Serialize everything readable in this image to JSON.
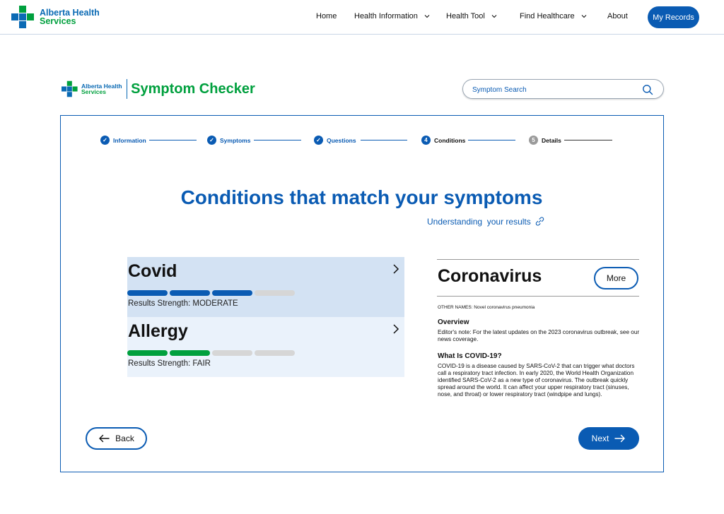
{
  "nav": {
    "logo_line1": "Alberta Health",
    "logo_line2": "Services",
    "items": [
      {
        "label": "Home"
      },
      {
        "label": "Health Information"
      },
      {
        "label": "Health Tool"
      },
      {
        "label": "Find Healthcare"
      },
      {
        "label": "About"
      }
    ],
    "records_button": "My Records"
  },
  "header": {
    "logo_line1": "Alberta Health",
    "logo_line2": "Services",
    "title": "Symptom Checker",
    "search_placeholder": "Symptom Search"
  },
  "steps": [
    {
      "label": "Information",
      "state": "done",
      "marker": "✓"
    },
    {
      "label": "Symptoms",
      "state": "done",
      "marker": "✓"
    },
    {
      "label": "Questions",
      "state": "done",
      "marker": "✓"
    },
    {
      "label": "Conditions",
      "state": "current",
      "marker": "4"
    },
    {
      "label": "Details",
      "state": "todo",
      "marker": "5"
    }
  ],
  "main": {
    "title": "Conditions that match your symptoms",
    "understand_link": "Understanding  your results"
  },
  "conditions": [
    {
      "name": "Covid",
      "strength_text": "Results Strength: MODERATE",
      "filled_segments": 3,
      "total_segments": 4,
      "color": "#0a5bb3"
    },
    {
      "name": "Allergy",
      "strength_text": "Results Strength: FAIR",
      "filled_segments": 2,
      "total_segments": 4,
      "color": "#00a03e"
    }
  ],
  "detail": {
    "title": "Coronavirus",
    "more_button": "More",
    "other_names": "OTHER NAMES: Novel coronavirus pneumonia",
    "overview_heading": "Overview",
    "overview_text": "Editor's note: For the latest updates on the 2023 coronavirus outbreak, see our news coverage.",
    "what_heading": "What Is COVID-19?",
    "what_text": "COVID-19 is a disease caused by SARS-CoV-2 that can trigger what doctors call a respiratory tract infection. In early 2020,  the World Health Organization identified SARS-CoV-2 as a new type of coronavirus. The outbreak quickly spread around the world.  It can affect your upper respiratory tract (sinuses, nose, and throat) or lower respiratory tract (windpipe and lungs)."
  },
  "footer": {
    "back_button": "Back",
    "next_button": "Next"
  },
  "colors": {
    "brand_blue": "#0a5bb3",
    "brand_green": "#00a03e",
    "selected_row_bg": "#d3e2f3",
    "row_bg": "#eaf2fb"
  },
  "icons": {
    "search": "search-icon",
    "chevron_right": "chevron-right-icon",
    "link": "link-icon",
    "arrow_left": "arrow-left-icon",
    "arrow_right": "arrow-right-icon"
  }
}
